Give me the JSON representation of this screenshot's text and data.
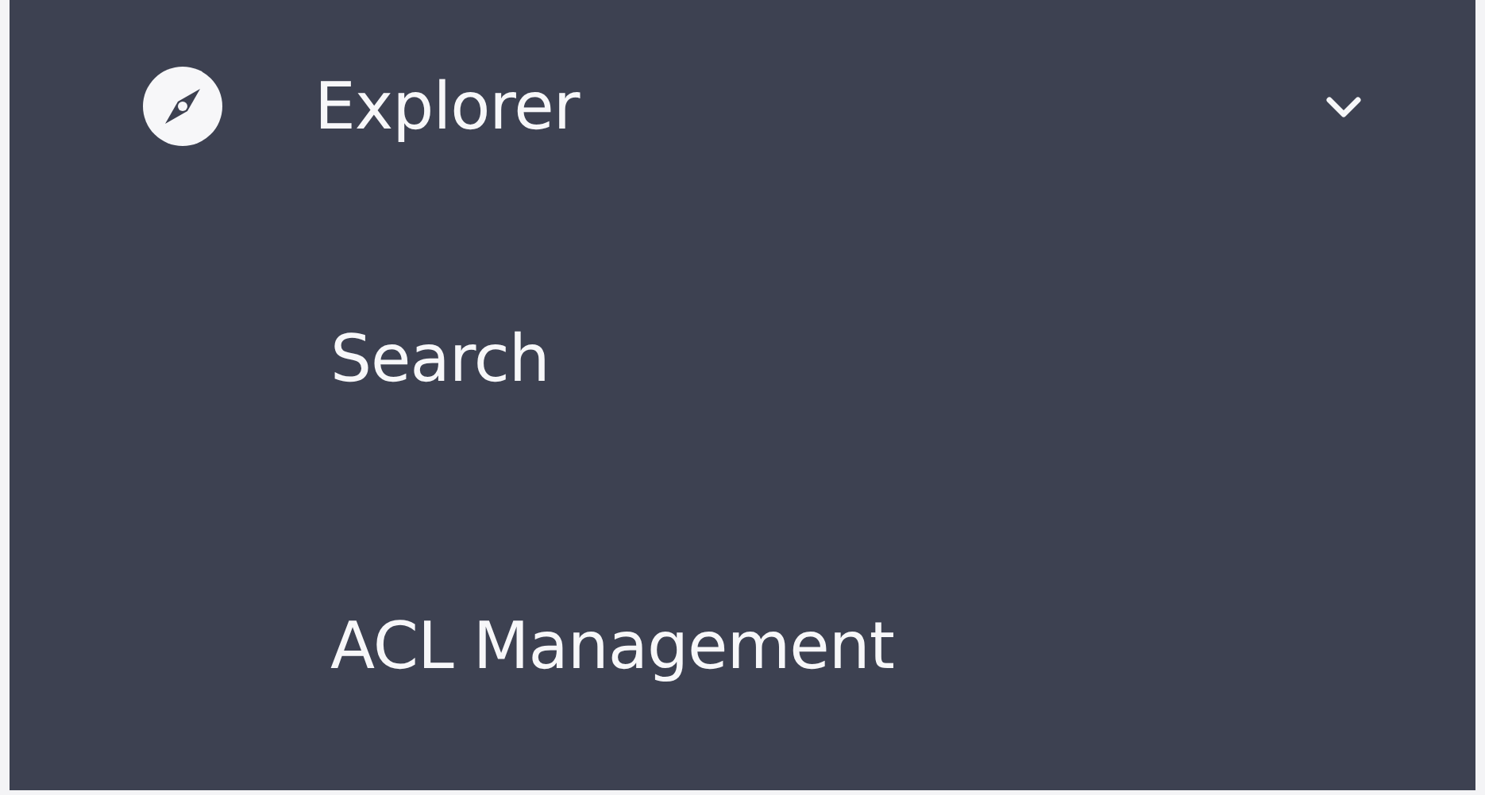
{
  "sidebar": {
    "items": [
      {
        "label": "Explorer",
        "expanded": true,
        "children": [
          {
            "label": "Search"
          },
          {
            "label": "ACL Management"
          }
        ]
      }
    ]
  }
}
